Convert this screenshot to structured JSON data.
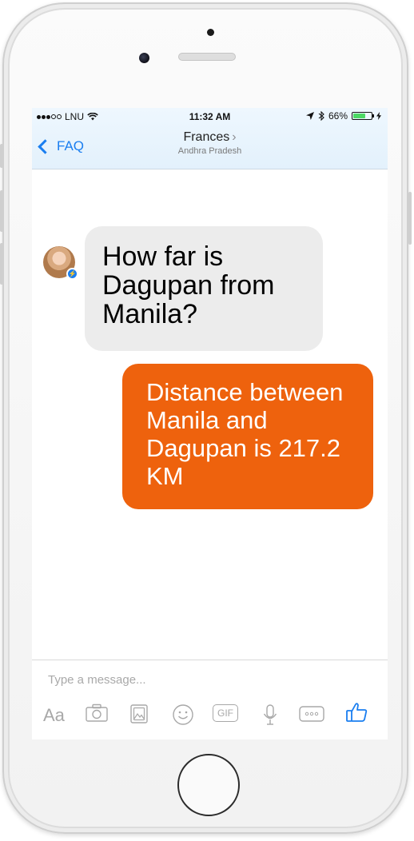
{
  "status_bar": {
    "carrier": "LNU",
    "time": "11:32 AM",
    "battery": "66%",
    "battery_level": 0.66
  },
  "nav": {
    "back_label": "FAQ",
    "title": "Frances",
    "subtitle": "Andhra Pradesh"
  },
  "messages": [
    {
      "from": "contact",
      "text": "How far is Dagupan from Manila?"
    },
    {
      "from": "me",
      "text": "Distance between Manila and Dagupan is 217.2 KM"
    }
  ],
  "composer": {
    "placeholder": "Type a message...",
    "text_tool": "Aa",
    "gif_tool": "GIF",
    "tools": [
      "text-icon",
      "camera-icon",
      "gallery-icon",
      "sticker-icon",
      "gif-icon",
      "microphone-icon",
      "more-icon",
      "like-icon"
    ]
  },
  "colors": {
    "accent": "#1a7ef0",
    "outgoing_bubble": "#ee620d",
    "incoming_bubble": "#ececec"
  }
}
